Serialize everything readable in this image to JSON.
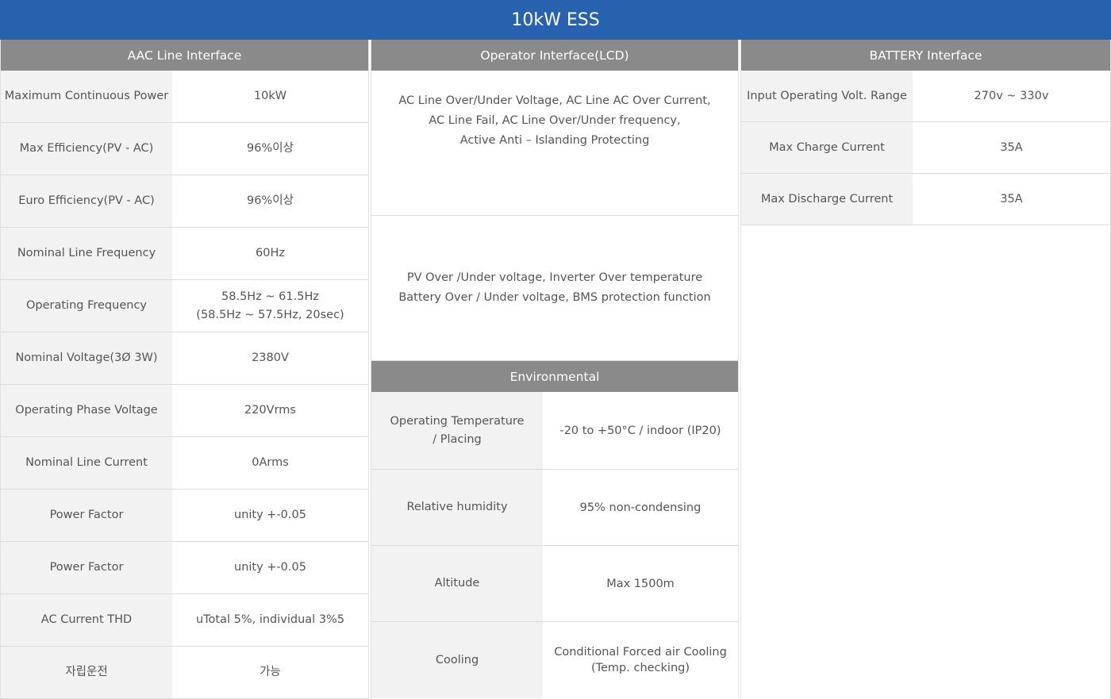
{
  "title": "10kW ESS",
  "ac_line": {
    "header": "AAC Line Interface",
    "rows": [
      {
        "label": "Maximum Continuous Power",
        "value": [
          "10kW"
        ]
      },
      {
        "label": "Max Efficiency(PV - AC)",
        "value": [
          "96%이상"
        ]
      },
      {
        "label": "Euro Efficiency(PV - AC)",
        "value": [
          "96%이상"
        ]
      },
      {
        "label": "Nominal Line Frequency",
        "value": [
          "60Hz"
        ]
      },
      {
        "label": "Operating Frequency",
        "value": [
          "58.5Hz ~ 61.5Hz",
          "(58.5Hz ~ 57.5Hz, 20sec)"
        ]
      },
      {
        "label": "Nominal Voltage(3Ø 3W)",
        "value": [
          "2380V"
        ]
      },
      {
        "label": "Operating Phase Voltage",
        "value": [
          "220Vrms"
        ]
      },
      {
        "label": "Nominal Line Current",
        "value": [
          "0Arms"
        ]
      },
      {
        "label": "Power Factor",
        "value": [
          "unity +-0.05"
        ]
      },
      {
        "label": "Power Factor",
        "value": [
          "unity +-0.05"
        ]
      },
      {
        "label": "AC Current THD",
        "value": [
          "uTotal 5%, individual 3%5"
        ]
      },
      {
        "label": "자립운전",
        "value": [
          "가능"
        ]
      }
    ]
  },
  "operator": {
    "header": "Operator Interface(LCD)",
    "block1": [
      "AC Line Over/Under Voltage, AC Line AC Over Current,",
      "AC Line Fail, AC Line Over/Under frequency,",
      "Active Anti – Islanding Protecting"
    ],
    "block2": [
      "PV Over /Under voltage, Inverter Over temperature",
      "Battery Over / Under voltage, BMS protection function"
    ]
  },
  "environmental": {
    "header": "Environmental",
    "rows": [
      {
        "label": [
          "Operating Temperature",
          "/ Placing"
        ],
        "value": [
          "-20 to +50°C / indoor (IP20)"
        ]
      },
      {
        "label": [
          "Relative humidity"
        ],
        "value": [
          "95% non-condensing"
        ]
      },
      {
        "label": [
          "Altitude"
        ],
        "value": [
          "Max 1500m"
        ]
      },
      {
        "label": [
          "Cooling"
        ],
        "value": [
          "Conditional Forced air Cooling",
          "(Temp. checking)"
        ]
      }
    ]
  },
  "battery": {
    "header": "BATTERY Interface",
    "rows": [
      {
        "label": "Input Operating Volt. Range",
        "value": "270v ~ 330v"
      },
      {
        "label": "Max Charge Current",
        "value": "35A"
      },
      {
        "label": "Max Discharge Current",
        "value": "35A"
      }
    ]
  }
}
